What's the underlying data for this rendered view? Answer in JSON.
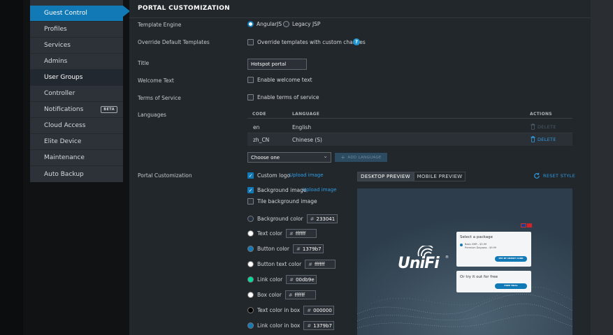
{
  "sidebar": {
    "items": [
      {
        "label": "Guest Control",
        "state": "active"
      },
      {
        "label": "Profiles",
        "state": ""
      },
      {
        "label": "Services",
        "state": ""
      },
      {
        "label": "Admins",
        "state": ""
      },
      {
        "label": "User Groups",
        "state": "group"
      },
      {
        "label": "Controller",
        "state": ""
      },
      {
        "label": "Notifications",
        "state": "",
        "badge": "BETA"
      },
      {
        "label": "Cloud Access",
        "state": ""
      },
      {
        "label": "Elite Device",
        "state": ""
      },
      {
        "label": "Maintenance",
        "state": ""
      },
      {
        "label": "Auto Backup",
        "state": ""
      }
    ]
  },
  "section_title": "PORTAL CUSTOMIZATION",
  "template_engine": {
    "label": "Template Engine",
    "options": [
      "AngularJS",
      "Legacy JSP"
    ],
    "selected": "AngularJS"
  },
  "override": {
    "label": "Override Default Templates",
    "checkbox_label": "Override templates with custom changes",
    "checked": false
  },
  "title_field": {
    "label": "Title",
    "value": "Hotspot portal"
  },
  "welcome": {
    "label": "Welcome Text",
    "checkbox_label": "Enable welcome text",
    "checked": false
  },
  "tos": {
    "label": "Terms of Service",
    "checkbox_label": "Enable terms of service",
    "checked": false
  },
  "languages": {
    "label": "Languages",
    "columns": [
      "CODE",
      "LANGUAGE",
      "ACTIONS"
    ],
    "rows": [
      {
        "code": "en",
        "language": "English",
        "action": "DELETE",
        "enabled": false
      },
      {
        "code": "zh_CN",
        "language": "Chinese (S)",
        "action": "DELETE",
        "enabled": true
      }
    ],
    "select_value": "Choose one",
    "add_button": "ADD LANGUAGE"
  },
  "portal": {
    "label": "Portal Customization",
    "custom_logo": {
      "label": "Custom logo",
      "link": "Upload image",
      "checked": true
    },
    "bg_image": {
      "label": "Background image",
      "link": "Upload image",
      "checked": true
    },
    "tile_bg": {
      "label": "Tile background image",
      "checked": false
    },
    "colors": [
      {
        "label": "Background color",
        "hex": "233041",
        "color": "#233041"
      },
      {
        "label": "Text color",
        "hex": "ffffff",
        "color": "#ffffff"
      },
      {
        "label": "Button color",
        "hex": "1379b7",
        "color": "#1379b7"
      },
      {
        "label": "Button text color",
        "hex": "ffffff",
        "color": "#ffffff"
      },
      {
        "label": "Link color",
        "hex": "00db9e",
        "color": "#00db9e"
      },
      {
        "label": "Box color",
        "hex": "ffffff",
        "color": "#ffffff"
      },
      {
        "label": "Text color in box",
        "hex": "000000",
        "color": "#000000"
      },
      {
        "label": "Link color in box",
        "hex": "1379b7",
        "color": "#1379b7"
      }
    ]
  },
  "preview": {
    "tabs": [
      "DESKTOP PREVIEW",
      "MOBILE PREVIEW"
    ],
    "active_tab": "DESKTOP PREVIEW",
    "reset": "RESET STYLE",
    "logo": "UniFi",
    "card1": {
      "title": "Select a package",
      "items": [
        "Basic 6HR - $5.99",
        "Premium Daypass - $9.99"
      ],
      "button": "PAY BY CREDIT CARD"
    },
    "card2": {
      "title": "Or try it out for free",
      "button": "FREE TRIAL"
    }
  },
  "colors": {
    "accent": "#1279b7",
    "page_bg": "#22272c",
    "sidebar_bg": "#2c3238"
  },
  "symbols": {
    "check": "✓",
    "question": "?",
    "hash": "#",
    "plus": "+",
    "chevron": "⌄",
    "registered": "®"
  }
}
